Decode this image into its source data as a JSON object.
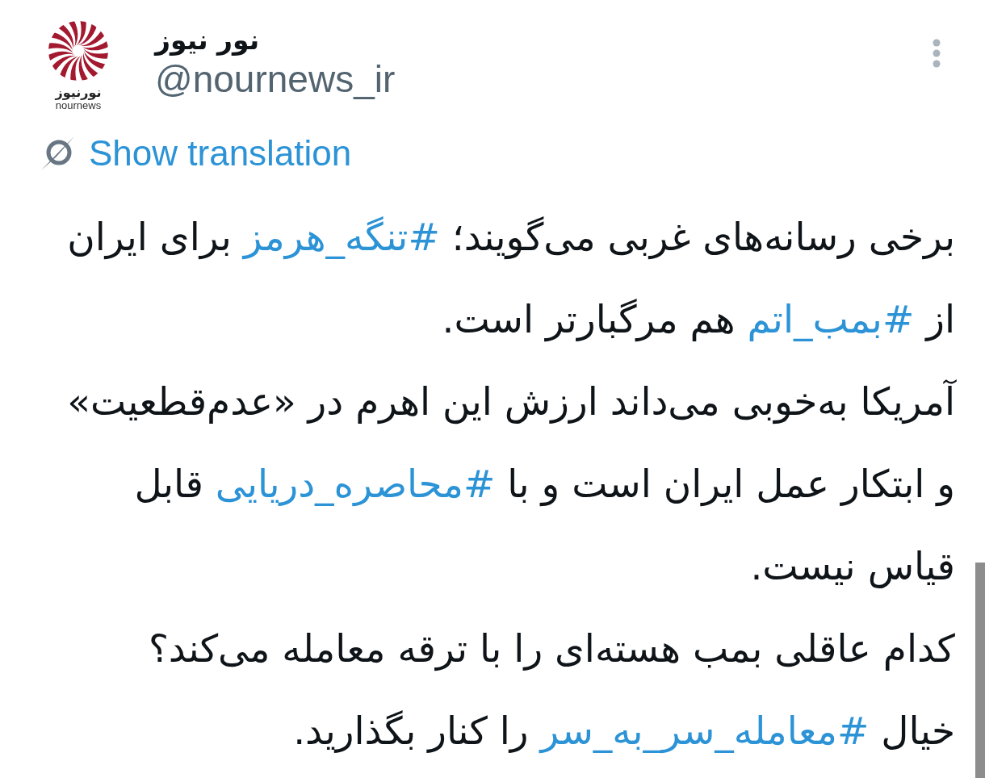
{
  "author": {
    "logo": {
      "wordmark": "نورنیوز",
      "caption": "nournews"
    },
    "name": "نور نیوز",
    "handle": "@nournews_ir"
  },
  "translate_link": "Show translation",
  "body": {
    "paragraphs": [
      {
        "segments": [
          {
            "kind": "text",
            "text": "برخی رسانه‌های غربی می‌گویند؛ "
          },
          {
            "kind": "hashtag",
            "text": "#تنگه_هرمز"
          },
          {
            "kind": "text",
            "text": " برای ایران از "
          },
          {
            "kind": "hashtag",
            "text": "#بمب_اتم"
          },
          {
            "kind": "text",
            "text": " هم مرگبارتر است."
          }
        ]
      },
      {
        "segments": [
          {
            "kind": "text",
            "text": "آمریکا به‌خوبی می‌داند ارزش این اهرم در «عدم‌قطعیت» و ابتکار عمل ایران است و با "
          },
          {
            "kind": "hashtag",
            "text": "#محاصره_دریایی"
          },
          {
            "kind": "text",
            "text": " قابل قیاس نیست."
          }
        ]
      },
      {
        "segments": [
          {
            "kind": "text",
            "text": "کدام عاقلی بمب هسته‌ای را با ترقه معامله می‌کند؟"
          }
        ]
      },
      {
        "segments": [
          {
            "kind": "text",
            "text": "خیال "
          },
          {
            "kind": "hashtag",
            "text": "#معامله_سر_به_سر"
          },
          {
            "kind": "text",
            "text": " را کنار بگذارید."
          }
        ]
      }
    ]
  }
}
